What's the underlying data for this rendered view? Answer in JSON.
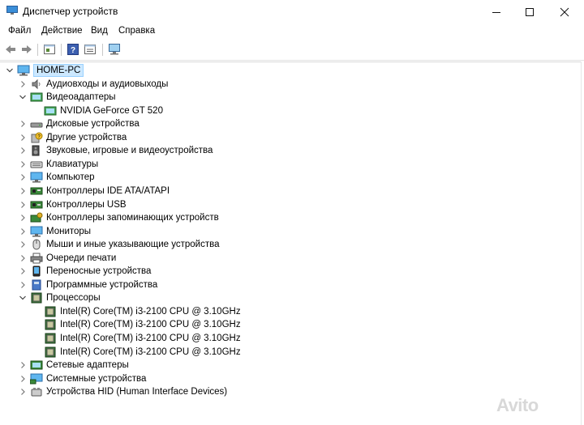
{
  "window": {
    "title": "Диспетчер устройств"
  },
  "menu": [
    "Файл",
    "Действие",
    "Вид",
    "Справка"
  ],
  "tree": {
    "root": "HOME-PC",
    "categories": [
      {
        "label": "Аудиовходы и аудиовыходы",
        "icon": "speaker-icon",
        "expanded": false
      },
      {
        "label": "Видеоадаптеры",
        "icon": "display-adapter-icon",
        "expanded": true,
        "children": [
          "NVIDIA GeForce GT 520"
        ]
      },
      {
        "label": "Дисковые устройства",
        "icon": "disk-drive-icon",
        "expanded": false
      },
      {
        "label": "Другие устройства",
        "icon": "unknown-device-icon",
        "expanded": false
      },
      {
        "label": "Звуковые, игровые и видеоустройства",
        "icon": "sound-icon",
        "expanded": false
      },
      {
        "label": "Клавиатуры",
        "icon": "keyboard-icon",
        "expanded": false
      },
      {
        "label": "Компьютер",
        "icon": "computer-icon",
        "expanded": false
      },
      {
        "label": "Контроллеры IDE ATA/ATAPI",
        "icon": "ide-controller-icon",
        "expanded": false
      },
      {
        "label": "Контроллеры USB",
        "icon": "usb-icon",
        "expanded": false
      },
      {
        "label": "Контроллеры запоминающих устройств",
        "icon": "storage-controller-icon",
        "expanded": false
      },
      {
        "label": "Мониторы",
        "icon": "monitor-icon",
        "expanded": false
      },
      {
        "label": "Мыши и иные указывающие устройства",
        "icon": "mouse-icon",
        "expanded": false
      },
      {
        "label": "Очереди печати",
        "icon": "printer-icon",
        "expanded": false
      },
      {
        "label": "Переносные устройства",
        "icon": "portable-device-icon",
        "expanded": false
      },
      {
        "label": "Программные устройства",
        "icon": "software-device-icon",
        "expanded": false
      },
      {
        "label": "Процессоры",
        "icon": "processor-icon",
        "expanded": true,
        "children": [
          "Intel(R) Core(TM) i3-2100 CPU @ 3.10GHz",
          "Intel(R) Core(TM) i3-2100 CPU @ 3.10GHz",
          "Intel(R) Core(TM) i3-2100 CPU @ 3.10GHz",
          "Intel(R) Core(TM) i3-2100 CPU @ 3.10GHz"
        ]
      },
      {
        "label": "Сетевые адаптеры",
        "icon": "network-adapter-icon",
        "expanded": false
      },
      {
        "label": "Системные устройства",
        "icon": "system-device-icon",
        "expanded": false
      },
      {
        "label": "Устройства HID (Human Interface Devices)",
        "icon": "hid-icon",
        "expanded": false
      }
    ]
  },
  "watermark": "Avito"
}
